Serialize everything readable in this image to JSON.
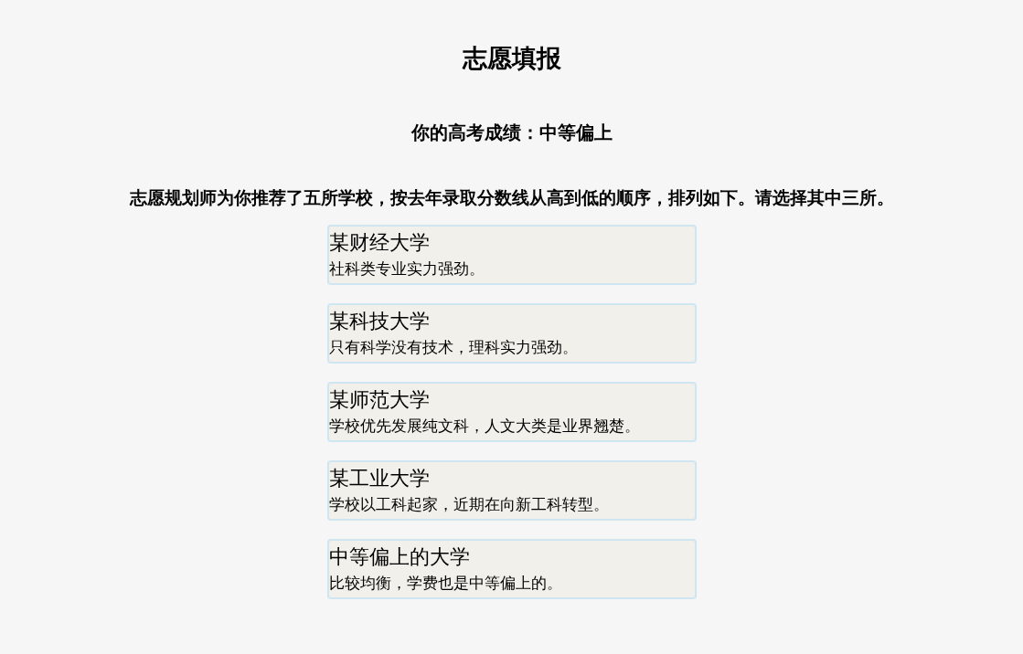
{
  "title": "志愿填报",
  "score": "你的高考成绩：中等偏上",
  "instruction": "志愿规划师为你推荐了五所学校，按去年录取分数线从高到低的顺序，排列如下。请选择其中三所。",
  "schools": [
    {
      "name": "某财经大学",
      "description": "社科类专业实力强劲。",
      "selected": false
    },
    {
      "name": "某科技大学",
      "description": "只有科学没有技术，理科实力强劲。",
      "selected": false
    },
    {
      "name": "某师范大学",
      "description": "学校优先发展纯文科，人文大类是业界翘楚。",
      "selected": false
    },
    {
      "name": "某工业大学",
      "description": "学校以工科起家，近期在向新工科转型。",
      "selected": false
    },
    {
      "name": "中等偏上的大学",
      "description": "比较均衡，学费也是中等偏上的。",
      "selected": false
    }
  ]
}
